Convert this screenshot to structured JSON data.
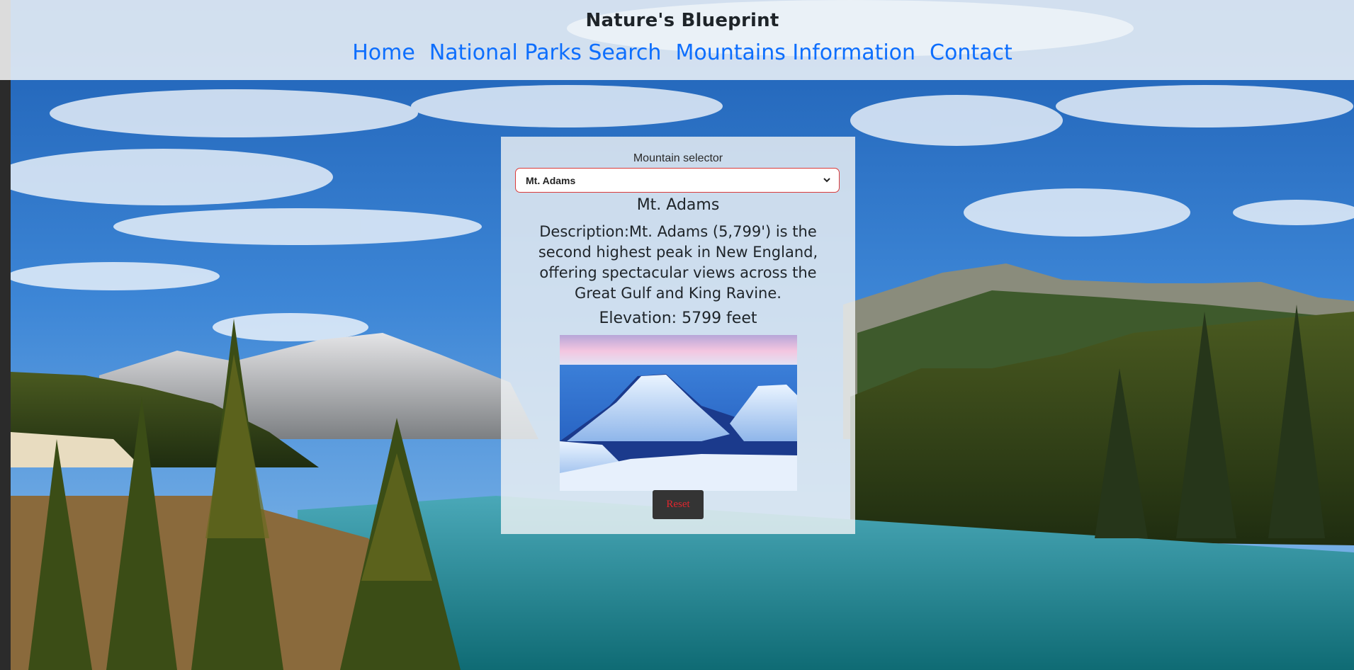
{
  "header": {
    "site_title": "Nature's Blueprint",
    "nav": [
      {
        "label": "Home"
      },
      {
        "label": "National Parks Search"
      },
      {
        "label": "Mountains Information"
      },
      {
        "label": "Contact"
      }
    ]
  },
  "mountain_panel": {
    "selector_label": "Mountain selector",
    "selected_mountain": "Mt. Adams",
    "name": "Mt. Adams",
    "description": "Description:Mt. Adams (5,799') is the second highest peak in New England, offering spectacular views across the Great Gulf and King Ravine.",
    "elevation": "Elevation: 5799 feet",
    "reset_label": "Reset"
  },
  "colors": {
    "nav_link": "#0d6efd",
    "reset_text": "#e0262e",
    "reset_bg": "#343434",
    "selector_border": "#d93a3a"
  },
  "icons": {
    "selector_arrow": "chevron-down-icon"
  }
}
